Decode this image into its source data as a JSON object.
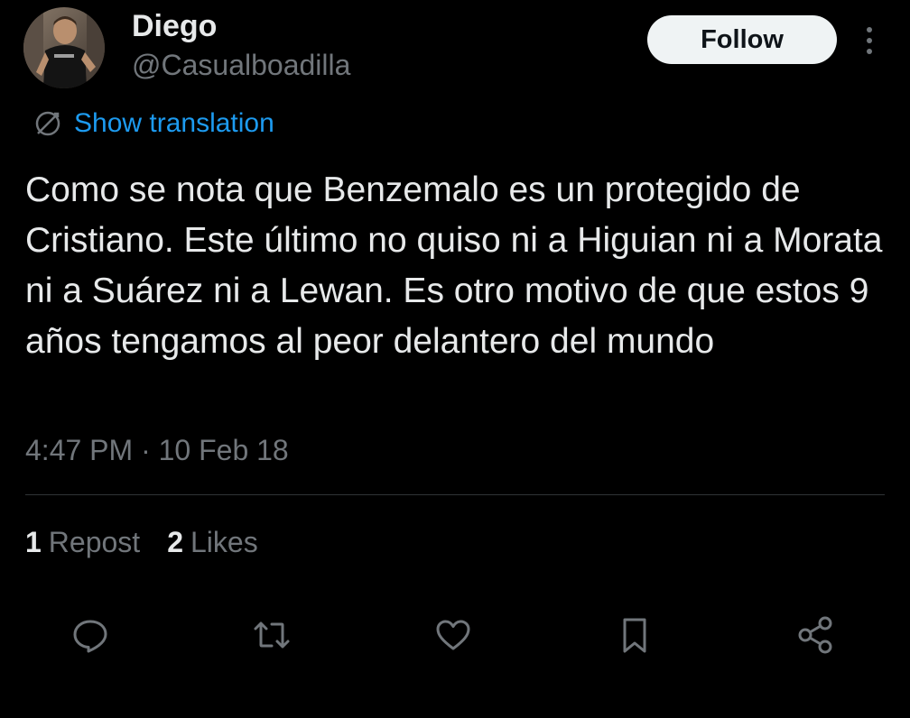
{
  "author": {
    "display_name": "Diego",
    "handle": "@Casualboadilla",
    "avatar_icon": "profile-photo"
  },
  "header": {
    "follow_label": "Follow",
    "more_icon": "more-vertical-icon"
  },
  "translation": {
    "label": "Show translation",
    "icon": "translate-icon"
  },
  "tweet": {
    "text": "Como se nota que Benzemalo es un protegido de Cristiano. Este último no quiso ni a Higuian ni a Morata ni a Suárez ni a Lewan. Es otro motivo de que estos 9 años tengamos al peor delantero del mundo",
    "timestamp": "4:47 PM · 10 Feb 18"
  },
  "stats": {
    "reposts_count": "1",
    "reposts_label": "Repost",
    "likes_count": "2",
    "likes_label": "Likes"
  },
  "actions": [
    "reply-icon",
    "repost-icon",
    "like-icon",
    "bookmark-icon",
    "share-icon"
  ],
  "colors": {
    "background": "#000000",
    "primary_text": "#e7e9ea",
    "secondary_text": "#71767b",
    "link": "#1d9bf0",
    "follow_bg": "#eff3f4",
    "divider": "#2f3336"
  }
}
